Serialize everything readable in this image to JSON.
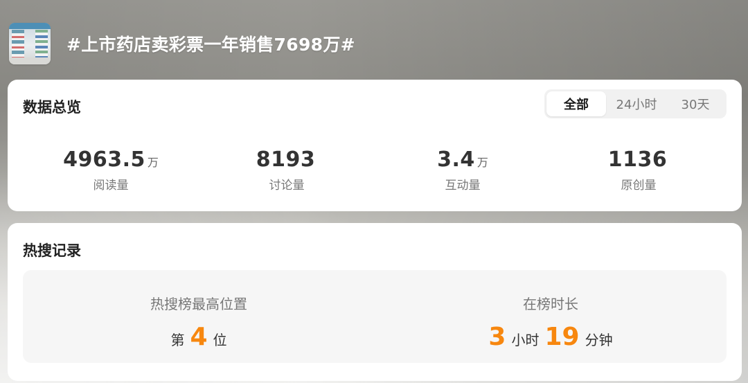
{
  "header": {
    "title": "#上市药店卖彩票一年销售7698万#",
    "thumbnail_icon": "pharmacy-thumbnail"
  },
  "overview": {
    "title": "数据总览",
    "tabs": [
      {
        "label": "全部",
        "active": true
      },
      {
        "label": "24小时",
        "active": false
      },
      {
        "label": "30天",
        "active": false
      }
    ],
    "stats": [
      {
        "value": "4963.5",
        "unit": "万",
        "label": "阅读量"
      },
      {
        "value": "8193",
        "unit": "",
        "label": "讨论量"
      },
      {
        "value": "3.4",
        "unit": "万",
        "label": "互动量"
      },
      {
        "value": "1136",
        "unit": "",
        "label": "原创量"
      }
    ]
  },
  "hot_search": {
    "title": "热搜记录",
    "peak_rank": {
      "label": "热搜榜最高位置",
      "prefix": "第",
      "value": "4",
      "suffix": "位"
    },
    "duration": {
      "label": "在榜时长",
      "hours": "3",
      "hours_unit": "小时",
      "minutes": "19",
      "minutes_unit": "分钟"
    }
  },
  "colors": {
    "accent": "#f7870f",
    "card_bg": "#ffffff",
    "panel_bg": "#f6f6f6"
  }
}
